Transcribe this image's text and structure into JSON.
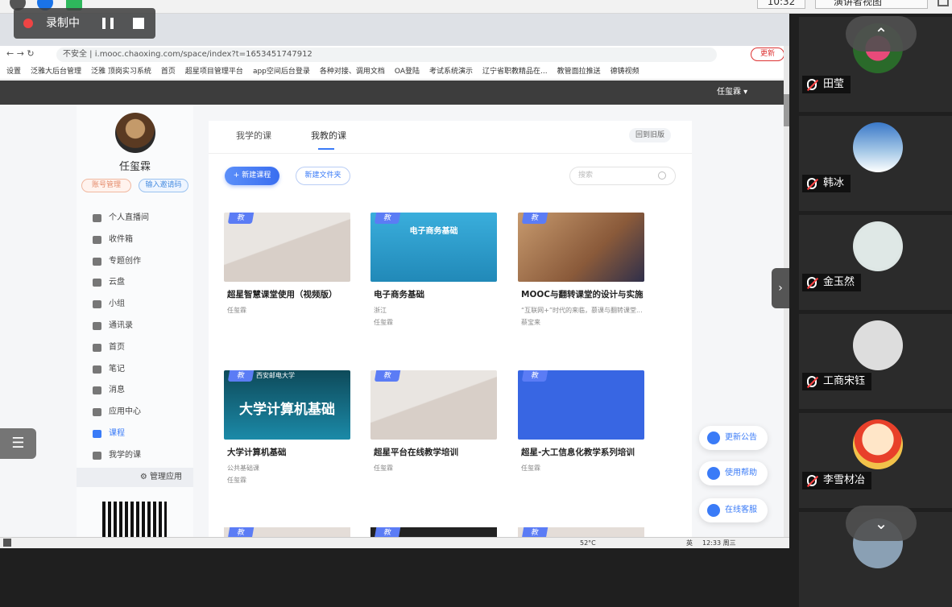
{
  "meeting": {
    "time": "10:32",
    "view_label": "演讲者视图"
  },
  "recording": {
    "label": "录制中"
  },
  "browser": {
    "url_prefix": "不安全",
    "url": "i.mooc.chaoxing.com/space/index?t=1653451747912",
    "update_label": "更新",
    "bookmarks": [
      "设置",
      "泛雅大后台管理",
      "泛雅 顶岗实习系统",
      "首页",
      "超星项目管理平台",
      "app空间后台登录",
      "各种对接、调用文档",
      "OA登陆",
      "考试系统演示",
      "辽宁省职教精品在...",
      "教管面拉推送",
      "德铸视频"
    ]
  },
  "site": {
    "user": "任玺霖"
  },
  "profile": {
    "name": "任玺霖",
    "account_btn": "账号管理",
    "invite_btn": "输入邀请码"
  },
  "nav": [
    {
      "label": "个人直播间"
    },
    {
      "label": "收件箱"
    },
    {
      "label": "专题创作"
    },
    {
      "label": "云盘"
    },
    {
      "label": "小组"
    },
    {
      "label": "通讯录"
    },
    {
      "label": "首页"
    },
    {
      "label": "笔记"
    },
    {
      "label": "消息"
    },
    {
      "label": "应用中心"
    },
    {
      "label": "课程"
    },
    {
      "label": "我学的课"
    }
  ],
  "manage_label": "管理应用",
  "tabs": {
    "learn": "我学的课",
    "teach": "我教的课",
    "old": "回到旧版"
  },
  "actions": {
    "new_course": "+ 新建课程",
    "new_folder": "新建文件夹",
    "search_placeholder": "搜索"
  },
  "badge": "教",
  "courses": [
    {
      "title": "超星智慧课堂使用（视频版）",
      "line1": "任玺霖",
      "line2": ""
    },
    {
      "title": "电子商务基础",
      "line1": "浙江",
      "line2": "任玺霖",
      "thumb_text": "电子商务基础"
    },
    {
      "title": "MOOC与翻转课堂的设计与实施",
      "line1": "“互联网+”时代的来临，慕课与翻转课堂...",
      "line2": "蔡宝来"
    },
    {
      "title": "大学计算机基础",
      "line1": "公共基础课",
      "line2": "任玺霖",
      "thumb_text": "大学计算机基础",
      "thumb_top": "西安邮电大学"
    },
    {
      "title": "超星平台在线教学培训",
      "line1": "任玺霖",
      "line2": ""
    },
    {
      "title": "超星-大工信息化教学系列培训",
      "line1": "任玺霖",
      "line2": ""
    }
  ],
  "floats": {
    "notice": "更新公告",
    "help": "使用帮助",
    "service": "在线客服"
  },
  "taskbar": {
    "temp": "52°C",
    "ime": "英",
    "clock": "12:33 周三"
  },
  "participants": [
    {
      "name": "田莹"
    },
    {
      "name": "韩冰"
    },
    {
      "name": "金玉然"
    },
    {
      "name": "工商宋钰"
    },
    {
      "name": "李雪材冶"
    },
    {
      "name": ""
    }
  ]
}
